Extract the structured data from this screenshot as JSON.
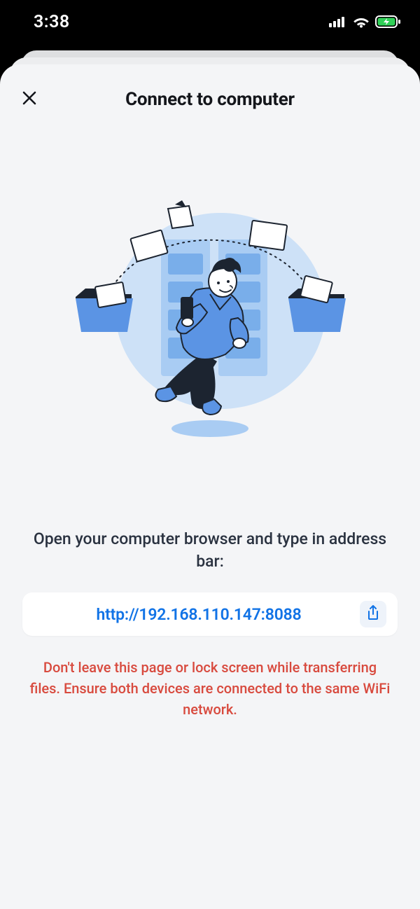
{
  "statusbar": {
    "time": "3:38"
  },
  "header": {
    "title": "Connect to computer"
  },
  "instruction": "Open your computer browser and type in address bar:",
  "url": "http://192.168.110.147:8088",
  "warning": "Don't leave this page or lock screen while transferring files. Ensure both devices are connected to the same WiFi network."
}
